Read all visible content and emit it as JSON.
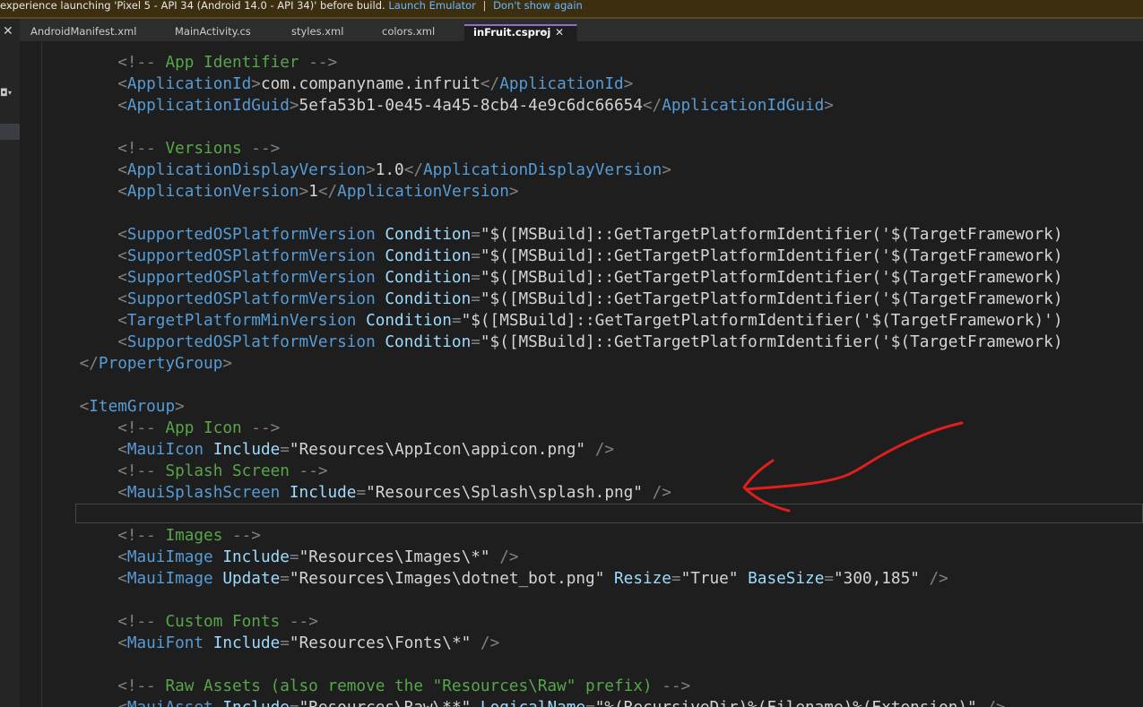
{
  "infobar": {
    "message": "experience launching 'Pixel 5 - API 34 (Android 14.0 - API 34)' before build.",
    "launch_link": "Launch Emulator",
    "separator": "|",
    "dismiss_link": "Don't show again"
  },
  "left_panel": {
    "close_glyph": "✕",
    "dropdown_glyph": "▾"
  },
  "tabs": [
    {
      "label": "AndroidManifest.xml"
    },
    {
      "label": "MainActivity.cs"
    },
    {
      "label": "styles.xml"
    },
    {
      "label": "colors.xml"
    },
    {
      "label": "inFruit.csproj",
      "active": true
    }
  ],
  "tab_active_pin": "⊸",
  "tab_active_close": "✕",
  "code": {
    "l01": {
      "indent": "        ",
      "open": "<!-- ",
      "text": "App Identifier",
      "close": " -->"
    },
    "l02": {
      "indent": "        ",
      "tag": "ApplicationId",
      "value": "com.companyname.infruit"
    },
    "l03": {
      "indent": "        ",
      "tag": "ApplicationIdGuid",
      "value": "5efa53b1-0e45-4a45-8cb4-4e9c6dc66654"
    },
    "l05": {
      "indent": "        ",
      "open": "<!-- ",
      "text": "Versions",
      "close": " -->"
    },
    "l06": {
      "indent": "        ",
      "tag": "ApplicationDisplayVersion",
      "value": "1.0"
    },
    "l07": {
      "indent": "        ",
      "tag": "ApplicationVersion",
      "value": "1"
    },
    "cond_line": {
      "indent": "        ",
      "tag": "SupportedOSPlatformVersion",
      "attr": "Condition",
      "value": "$([MSBuild]::GetTargetPlatformIdentifier('$(TargetFramework)"
    },
    "l13": {
      "indent": "        ",
      "tag": "TargetPlatformMinVersion",
      "attr": "Condition",
      "value": "$([MSBuild]::GetTargetPlatformIdentifier('$(TargetFramework)')"
    },
    "l15": {
      "indent": "    ",
      "tag": "PropertyGroup"
    },
    "l17": {
      "indent": "    ",
      "tag": "ItemGroup"
    },
    "l18": {
      "indent": "        ",
      "open": "<!-- ",
      "text": "App Icon",
      "close": " -->"
    },
    "l19": {
      "indent": "        ",
      "tag": "MauiIcon",
      "attr": "Include",
      "value": "Resources\\AppIcon\\appicon.png"
    },
    "l20": {
      "indent": "        ",
      "open": "<!-- ",
      "text": "Splash Screen",
      "close": " -->"
    },
    "l21": {
      "indent": "        ",
      "tag": "MauiSplashScreen",
      "attr": "Include",
      "value": "Resources\\Splash\\splash.png"
    },
    "l23": {
      "indent": "        ",
      "open": "<!-- ",
      "text": "Images",
      "close": " -->"
    },
    "l24": {
      "indent": "        ",
      "tag": "MauiImage",
      "attr": "Include",
      "value": "Resources\\Images\\*"
    },
    "l25": {
      "indent": "        ",
      "tag": "MauiImage",
      "attr": "Update",
      "value": "Resources\\Images\\dotnet_bot.png",
      "attr2": "Resize",
      "value2": "True",
      "attr3": "BaseSize",
      "value3": "300,185"
    },
    "l27": {
      "indent": "        ",
      "open": "<!-- ",
      "text": "Custom Fonts",
      "close": " -->"
    },
    "l28": {
      "indent": "        ",
      "tag": "MauiFont",
      "attr": "Include",
      "value": "Resources\\Fonts\\*"
    },
    "l30": {
      "indent": "        ",
      "open": "<!-- ",
      "text": "Raw Assets (also remove the \"Resources\\Raw\" prefix)",
      "close": " -->"
    },
    "l31": {
      "indent": "        ",
      "tag": "MauiAsset",
      "attr": "Include",
      "value": "Resources\\Raw\\**",
      "attr2": "LogicalName",
      "value2": "%(RecursiveDir)%(Filename)%(Extension)"
    }
  },
  "annotation": {
    "color": "#e01e1e",
    "shape": "hand-drawn arrow"
  }
}
